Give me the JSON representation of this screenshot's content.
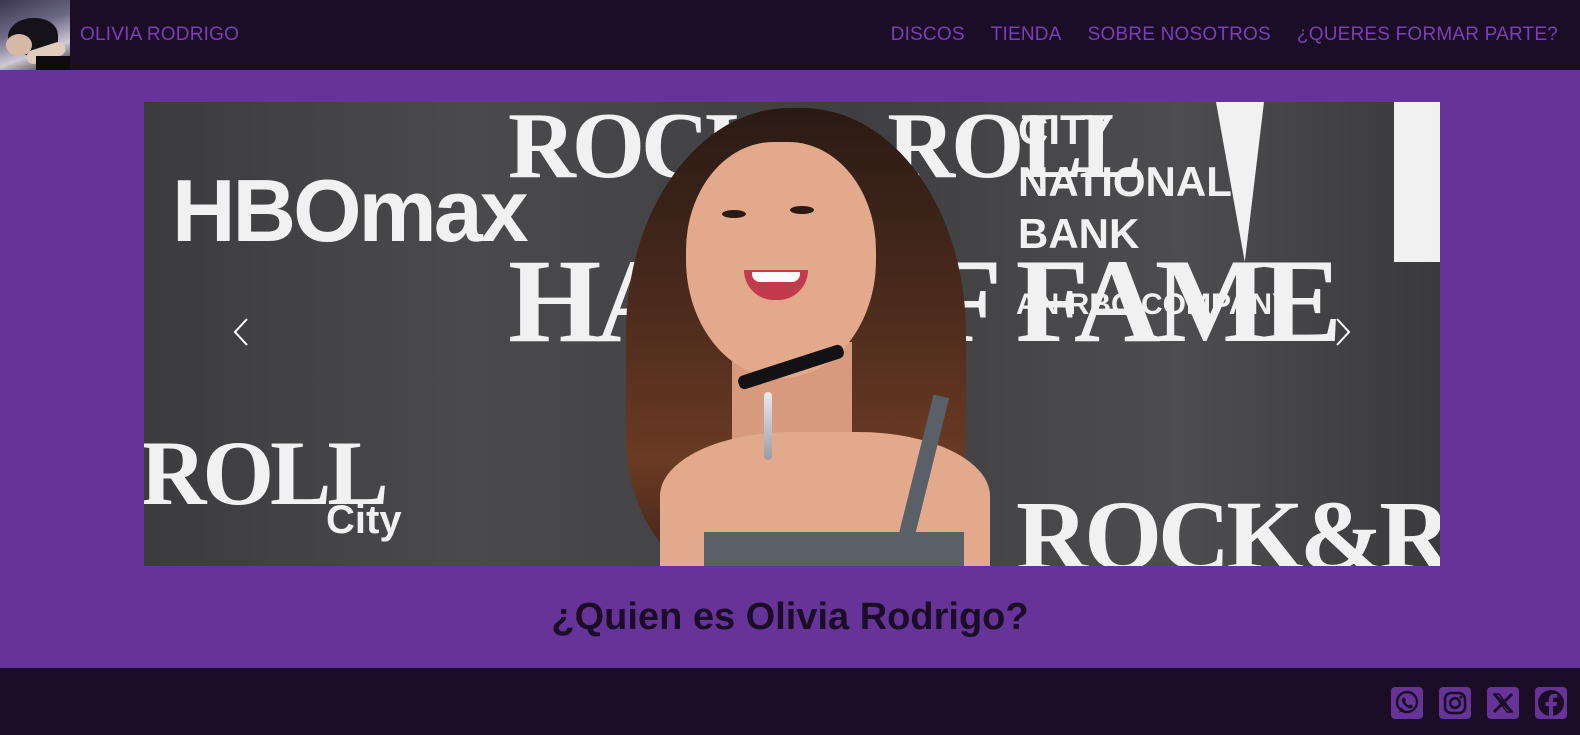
{
  "navbar": {
    "brand_text": "OLIVIA RODRIGO",
    "links": [
      "DISCOS",
      "TIENDA",
      "SOBRE NOSOTROS",
      "¿QUERES FORMAR PARTE?"
    ]
  },
  "carousel": {
    "background_text": [
      "HBOmax",
      "ROCK & ROLL",
      "HALL OF FAME",
      "CITY",
      "NATIONAL",
      "BANK",
      "AN RBC COMPANY",
      "ROLL",
      "City",
      "ROCK&R"
    ],
    "prev_icon": "chevron-left-icon",
    "next_icon": "chevron-right-icon"
  },
  "main": {
    "heading": "¿Quien es Olivia Rodrigo?"
  },
  "footer": {
    "social": [
      "whatsapp-icon",
      "instagram-icon",
      "x-icon",
      "facebook-icon"
    ]
  },
  "colors": {
    "nav_bg": "#1c0d26",
    "page_bg": "#663399",
    "accent": "#7a3fb8"
  }
}
